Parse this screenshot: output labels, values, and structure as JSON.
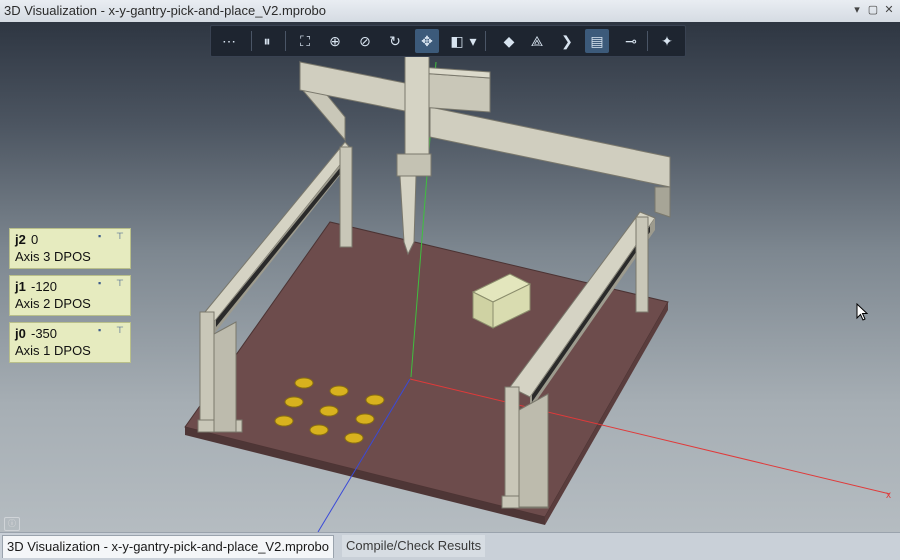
{
  "window": {
    "title": "3D Visualization - x-y-gantry-pick-and-place_V2.mprobo",
    "controls": [
      "chevron-down-icon",
      "maximize-icon",
      "close-icon"
    ]
  },
  "toolbar": {
    "buttons": [
      {
        "icon": "more-options-icon",
        "glyph": "⋯"
      },
      {
        "icon": "pause-icon",
        "glyph": "⏸"
      },
      {
        "icon": "fit-to-view-icon",
        "glyph": "⛶"
      },
      {
        "icon": "zoom-in-icon",
        "glyph": "⊕"
      },
      {
        "icon": "zoom-area-icon",
        "glyph": "⊘"
      },
      {
        "icon": "rotate-icon",
        "glyph": "↻"
      },
      {
        "icon": "pan-icon",
        "glyph": "✥"
      },
      {
        "icon": "view-cube-icon",
        "glyph": "◧"
      },
      {
        "icon": "dropdown-arrow-icon",
        "glyph": "▾"
      },
      {
        "icon": "render-mode-icon",
        "glyph": "◆"
      },
      {
        "icon": "axes-icon",
        "glyph": "⟁"
      },
      {
        "icon": "next-icon",
        "glyph": "❯"
      },
      {
        "icon": "joint-panels-icon",
        "glyph": "▤"
      },
      {
        "icon": "measure-icon",
        "glyph": "⊸"
      },
      {
        "icon": "settings-tool-icon",
        "glyph": "✦"
      }
    ]
  },
  "joints": [
    {
      "name": "j2",
      "value": "0",
      "label": "Axis 3 DPOS"
    },
    {
      "name": "j1",
      "value": "-120",
      "label": "Axis 2 DPOS"
    },
    {
      "name": "j0",
      "value": "-350",
      "label": "Axis 1 DPOS"
    }
  ],
  "axis": {
    "x_label": "x"
  },
  "tabs": [
    {
      "label": "3D Visualization - x-y-gantry-pick-and-place_V2.mprobo",
      "active": true
    },
    {
      "label": "Compile/Check Results",
      "active": false
    }
  ],
  "colors": {
    "floor": "#6d4c4c",
    "frame": "#c9c7b8",
    "parts": "#d8b21e",
    "box": "#d9dcb0",
    "panel": "#e6ebbf"
  }
}
